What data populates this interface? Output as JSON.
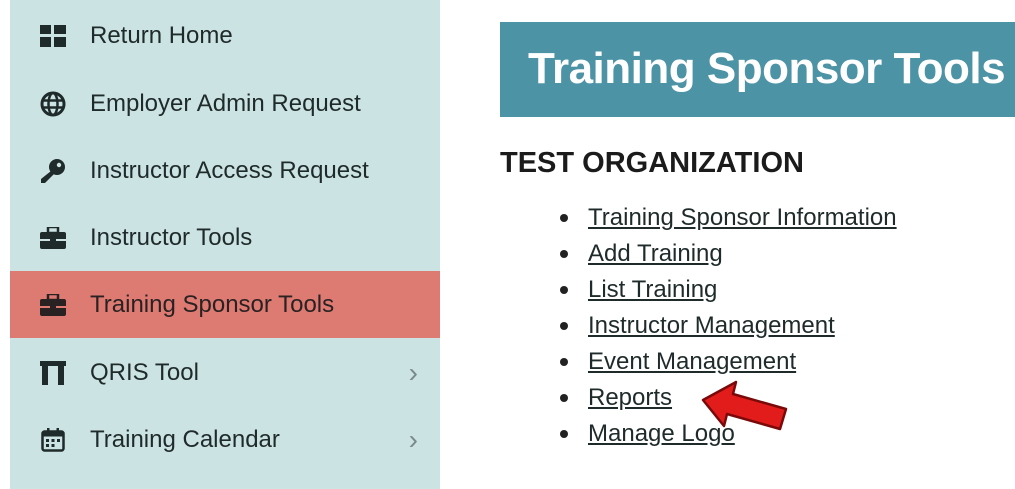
{
  "sidebar": {
    "items": [
      {
        "label": "Return Home",
        "icon": "grid-icon",
        "active": false,
        "has_chevron": false
      },
      {
        "label": "Employer Admin Request",
        "icon": "globe-icon",
        "active": false,
        "has_chevron": false
      },
      {
        "label": "Instructor Access Request",
        "icon": "key-icon",
        "active": false,
        "has_chevron": false
      },
      {
        "label": "Instructor Tools",
        "icon": "toolbox-icon",
        "active": false,
        "has_chevron": false
      },
      {
        "label": "Training Sponsor Tools",
        "icon": "toolbox-icon",
        "active": true,
        "has_chevron": false
      },
      {
        "label": "QRIS Tool",
        "icon": "arch-icon",
        "active": false,
        "has_chevron": true
      },
      {
        "label": "Training Calendar",
        "icon": "calendar-icon",
        "active": false,
        "has_chevron": true
      }
    ],
    "chevron": "›"
  },
  "header": {
    "title": "Training Sponsor Tools"
  },
  "main": {
    "org_name": "TEST ORGANIZATION",
    "links": [
      "Training Sponsor Information",
      "Add Training",
      "List Training",
      "Instructor Management",
      "Event Management",
      "Reports",
      "Manage Logo"
    ]
  },
  "colors": {
    "sidebar_bg": "#cce3e4",
    "active_bg": "#dd7b73",
    "header_bg": "#4c93a5",
    "arrow": "#e21b1b"
  }
}
